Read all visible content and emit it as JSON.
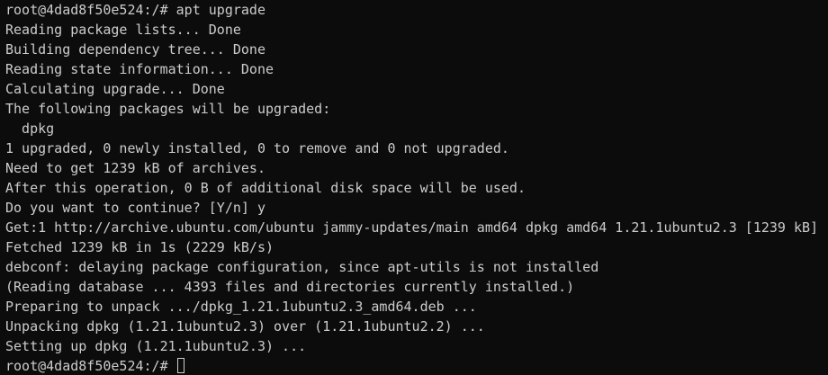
{
  "terminal": {
    "lines": [
      "root@4dad8f50e524:/# apt upgrade",
      "Reading package lists... Done",
      "Building dependency tree... Done",
      "Reading state information... Done",
      "Calculating upgrade... Done",
      "The following packages will be upgraded:",
      "  dpkg",
      "1 upgraded, 0 newly installed, 0 to remove and 0 not upgraded.",
      "Need to get 1239 kB of archives.",
      "After this operation, 0 B of additional disk space will be used.",
      "Do you want to continue? [Y/n] y",
      "Get:1 http://archive.ubuntu.com/ubuntu jammy-updates/main amd64 dpkg amd64 1.21.1ubuntu2.3 [1239 kB]",
      "Fetched 1239 kB in 1s (2229 kB/s)",
      "debconf: delaying package configuration, since apt-utils is not installed",
      "(Reading database ... 4393 files and directories currently installed.)",
      "Preparing to unpack .../dpkg_1.21.1ubuntu2.3_amd64.deb ...",
      "Unpacking dpkg (1.21.1ubuntu2.3) over (1.21.1ubuntu2.2) ...",
      "Setting up dpkg (1.21.1ubuntu2.3) ..."
    ],
    "prompt": "root@4dad8f50e524:/# "
  },
  "colors": {
    "background": "#0c0c0c",
    "foreground": "#cccccc"
  }
}
